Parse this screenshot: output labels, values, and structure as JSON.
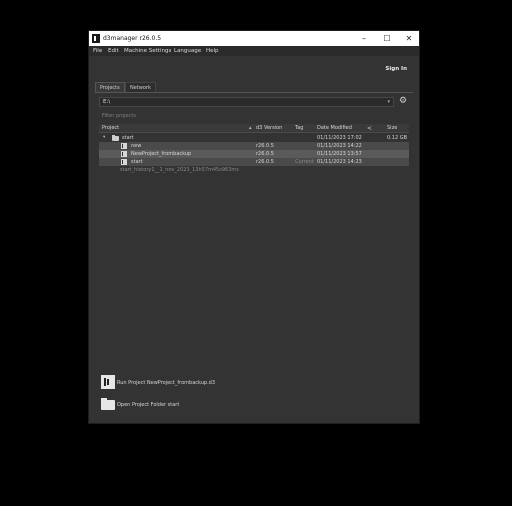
{
  "window": {
    "title": "d3manager  r26.0.5",
    "controls": {
      "minimize": "–",
      "maximize": "☐",
      "close": "✕"
    }
  },
  "menu": [
    "File",
    "Edit",
    "Machine Settings",
    "Language",
    "Help"
  ],
  "account": {
    "sign_in_label": "Sign In"
  },
  "tabs": [
    {
      "label": "Projects",
      "active": true
    },
    {
      "label": "Network",
      "active": false
    }
  ],
  "path_selector": {
    "value": "E:\\",
    "caret": "▾"
  },
  "settings_icon": "gear-icon",
  "filter": {
    "placeholder": "Filter projects"
  },
  "table": {
    "columns": [
      "Project",
      "d3 Version",
      "Tag",
      "Date Modified",
      "Size"
    ],
    "sort_indicator": "▴",
    "rows": [
      {
        "name": "start",
        "type": "folder",
        "version": "",
        "tag": "",
        "date": "01/11/2023 17:02",
        "size": "0.12 GB"
      },
      {
        "name": "new",
        "type": "project",
        "version": "r26.0.5",
        "tag": "",
        "date": "01/11/2023 14:22",
        "size": ""
      },
      {
        "name": "NewProject_frombackup",
        "type": "project",
        "version": "r26.0.5",
        "tag": "",
        "date": "01/11/2023 13:57",
        "size": ""
      },
      {
        "name": "start",
        "type": "project",
        "version": "r26.0.5",
        "tag": "Current",
        "date": "01/11/2023 14:23",
        "size": ""
      },
      {
        "name": "start_history1__1_nov_2023_13h57m45s963ms",
        "type": "history",
        "version": "",
        "tag": "",
        "date": "",
        "size": ""
      }
    ]
  },
  "actions": {
    "run_label": "Run Project NewProject_frombackup.d3",
    "open_folder_label": "Open Project Folder start"
  }
}
